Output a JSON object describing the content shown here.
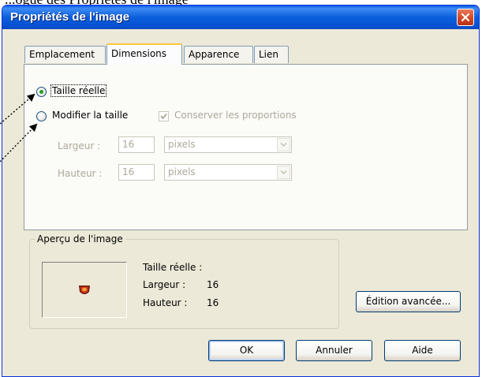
{
  "caption_cut": "...ogue des Propriétés de l'image",
  "window": {
    "title": "Propriétés de l'image"
  },
  "tabs": [
    {
      "label": "Emplacement",
      "active": false
    },
    {
      "label": "Dimensions",
      "active": true
    },
    {
      "label": "Apparence",
      "active": false
    },
    {
      "label": "Lien",
      "active": false
    }
  ],
  "dimensions": {
    "actual_size_label": "Taille réelle",
    "actual_size_selected": true,
    "custom_size_label": "Modifier la taille",
    "custom_size_selected": false,
    "constrain_label": "Conserver les proportions",
    "constrain_checked": true,
    "width_label": "Largeur :",
    "width_value": "16",
    "width_unit": "pixels",
    "height_label": "Hauteur :",
    "height_value": "16",
    "height_unit": "pixels"
  },
  "preview": {
    "legend": "Aperçu de l'image",
    "actual_size_heading": "Taille réelle :",
    "width_label": "Largeur :",
    "width_value": "16",
    "height_label": "Hauteur :",
    "height_value": "16"
  },
  "buttons": {
    "advanced_edit": "Édition avancée...",
    "ok": "OK",
    "cancel": "Annuler",
    "help": "Aide"
  },
  "colors": {
    "titlebar": "#0c5fdc",
    "dialog_bg": "#ece9d8",
    "close_button": "#d24320",
    "radio_dot": "#21a121",
    "active_tab_accent": "#ffc83c"
  }
}
